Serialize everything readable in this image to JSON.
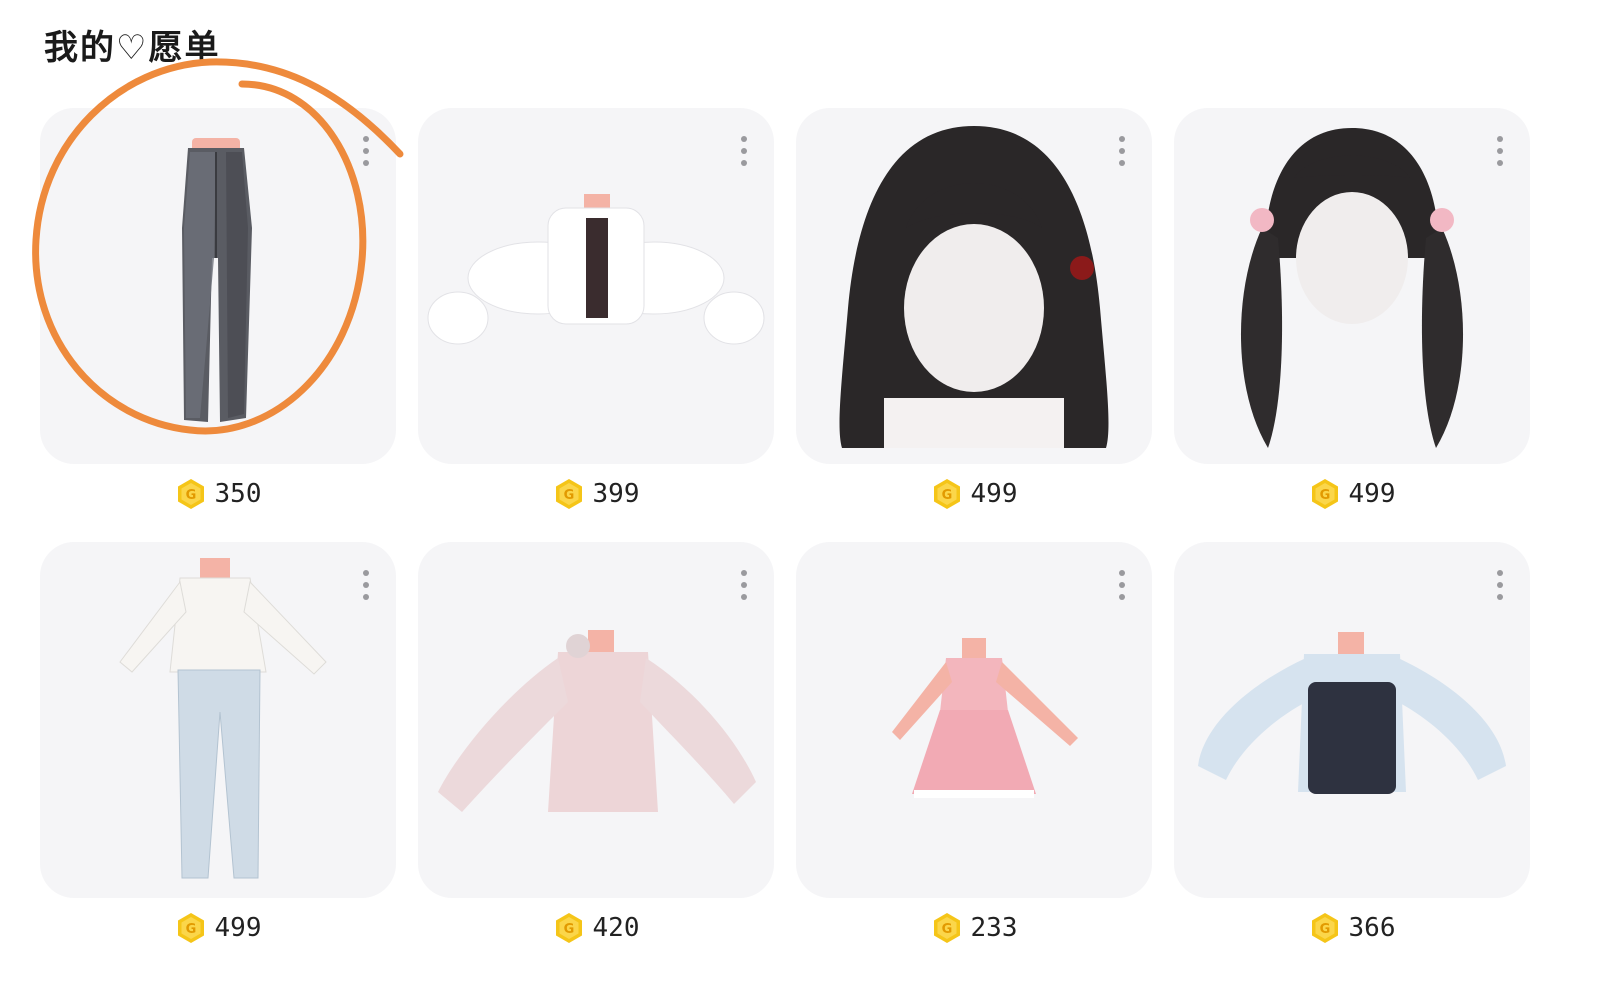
{
  "page": {
    "title": "我的♡愿单"
  },
  "colors": {
    "card_bg": "#f5f5f7",
    "coin": "#f5c518",
    "annotation": "#ee8a3c"
  },
  "items": [
    {
      "name": "grey flared jeans",
      "price": "350",
      "icon": "jeans-item"
    },
    {
      "name": "white fluffy cropped jacket",
      "price": "399",
      "icon": "jacket-item"
    },
    {
      "name": "long black hair with red bow",
      "price": "499",
      "icon": "long-hair-item"
    },
    {
      "name": "black twin-tail hair with pink bows",
      "price": "499",
      "icon": "twin-tail-hair-item"
    },
    {
      "name": "white top and light jeans outfit",
      "price": "499",
      "icon": "outfit-item"
    },
    {
      "name": "pink off-shoulder sweater",
      "price": "420",
      "icon": "sweater-item"
    },
    {
      "name": "pink plaid dress",
      "price": "233",
      "icon": "dress-item"
    },
    {
      "name": "blue shirt with black overall",
      "price": "366",
      "icon": "shirt-item"
    }
  ]
}
